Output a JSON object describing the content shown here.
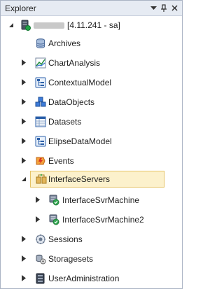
{
  "panel": {
    "title": "Explorer",
    "dropdown_icon": "▾",
    "pin_icon": "pin",
    "close_icon": "×"
  },
  "root": {
    "label": "[4.11.241 - sa]",
    "server_name_redacted": true,
    "expanded": true
  },
  "tree": [
    {
      "id": "archives",
      "label": "Archives",
      "icon": "archive-icon",
      "has_children": false
    },
    {
      "id": "chartanalysis",
      "label": "ChartAnalysis",
      "icon": "chart-icon",
      "has_children": true
    },
    {
      "id": "contextualmodel",
      "label": "ContextualModel",
      "icon": "model-icon",
      "has_children": true
    },
    {
      "id": "dataobjects",
      "label": "DataObjects",
      "icon": "cubes-icon",
      "has_children": true
    },
    {
      "id": "datasets",
      "label": "Datasets",
      "icon": "dataset-icon",
      "has_children": true
    },
    {
      "id": "elipsedatamodel",
      "label": "ElipseDataModel",
      "icon": "model-icon",
      "has_children": true
    },
    {
      "id": "events",
      "label": "Events",
      "icon": "events-icon",
      "has_children": true
    },
    {
      "id": "interfaceservers",
      "label": "InterfaceServers",
      "icon": "servers-icon",
      "has_children": true,
      "expanded": true,
      "selected": true,
      "children": [
        {
          "id": "svr1",
          "label": "InterfaceSvrMachine",
          "icon": "server-machine-icon"
        },
        {
          "id": "svr2",
          "label": "InterfaceSvrMachine2",
          "icon": "server-machine-icon"
        }
      ]
    },
    {
      "id": "sessions",
      "label": "Sessions",
      "icon": "sessions-icon",
      "has_children": true
    },
    {
      "id": "storagesets",
      "label": "Storagesets",
      "icon": "storage-icon",
      "has_children": true
    },
    {
      "id": "useradministration",
      "label": "UserAdministration",
      "icon": "users-icon",
      "has_children": true
    }
  ],
  "colors": {
    "selection_bg": "#fcf1cc",
    "selection_border": "#e5c365",
    "titlebar_bg": "#e6ebf3"
  }
}
